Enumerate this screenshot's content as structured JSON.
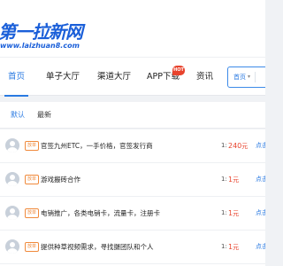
{
  "logo": {
    "main": "第一拉新网",
    "sub": "www.laizhuan8.com"
  },
  "nav": {
    "items": [
      "首页",
      "单子大厅",
      "渠道大厅",
      "APP下载",
      "资讯"
    ],
    "hot_badge": "HOT",
    "active_index": 0
  },
  "search": {
    "select_label": "首页",
    "caret": "▾"
  },
  "tabs": [
    "默认",
    "最新"
  ],
  "list": {
    "rows": [
      {
        "tag": "放单",
        "title": "官签九州ETC，一手价格，官签发行商",
        "qty": "1:",
        "price": "240",
        "unit": "元",
        "action": "点击"
      },
      {
        "tag": "放单",
        "title": "游戏搬砖合作",
        "qty": "1:",
        "price": "1",
        "unit": "元",
        "action": "点击"
      },
      {
        "tag": "放单",
        "title": "电销推广，各类电销卡，流量卡，注册卡",
        "qty": "1:",
        "price": "1",
        "unit": "元",
        "action": "点击"
      },
      {
        "tag": "放单",
        "title": "提供种草视频需求，寻找摄团队和个人",
        "qty": "1:",
        "price": "1",
        "unit": "元",
        "action": "点击"
      }
    ]
  },
  "colors": {
    "accent": "#2a7ae2",
    "logo": "#1a5fd9",
    "price": "#e8432d",
    "tag": "#f08a3c"
  }
}
